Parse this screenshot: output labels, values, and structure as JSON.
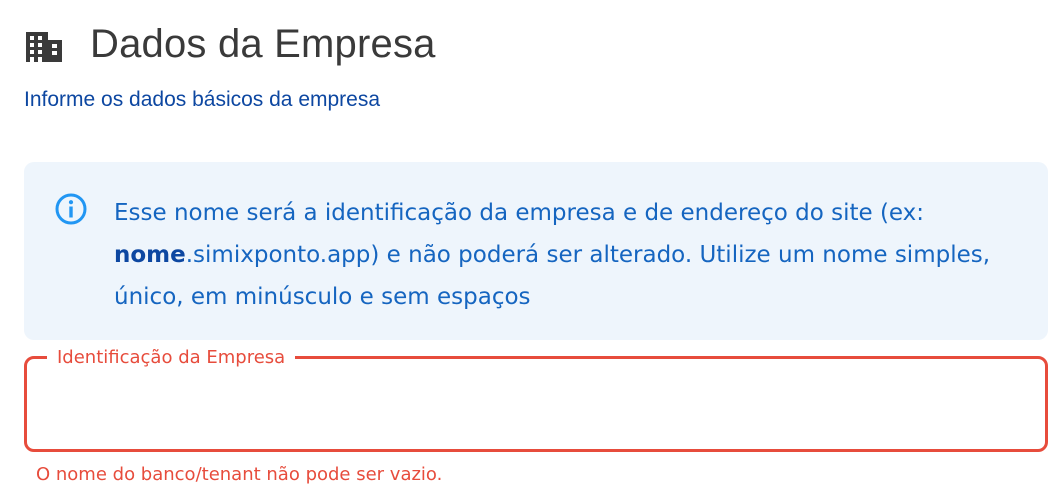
{
  "header": {
    "icon": "building-icon",
    "title": "Dados da Empresa"
  },
  "subtitle": "Informe os dados básicos da empresa",
  "info": {
    "icon": "info-icon",
    "text_part1": "Esse nome será a identificação da empresa e de endereço do site (ex: ",
    "text_bold": "nome",
    "text_part2": ".simixponto.app) e não poderá ser alterado. Utilize um nome simples, único, em minúsculo e sem espaços",
    "color": "#1565c0",
    "background": "#eef5fc"
  },
  "company_id_field": {
    "label": "Identificação da Empresa",
    "value": "",
    "error": "O nome do banco/tenant não pode ser vazio.",
    "error_color": "#e74c3c"
  }
}
